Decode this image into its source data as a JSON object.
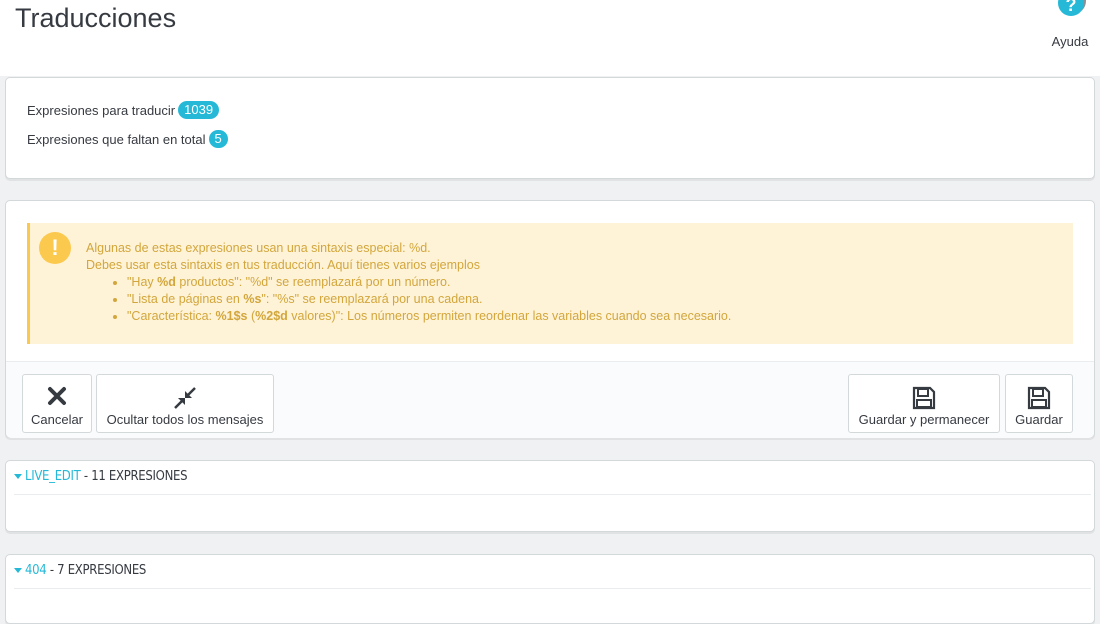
{
  "header": {
    "title": "Traducciones",
    "help_label": "Ayuda",
    "help_icon": "question-icon"
  },
  "stats": {
    "to_translate_label": "Expresiones para traducir",
    "to_translate_count": "1039",
    "missing_label": "Expresiones que faltan en total",
    "missing_count": "5"
  },
  "alert": {
    "icon": "exclamation-icon",
    "line1": "Algunas de estas expresiones usan una sintaxis especial: %d.",
    "line2": "Debes usar esta sintaxis en tus traducción. Aquí tienes varios ejemplos",
    "examples": [
      {
        "pre": "\"Hay ",
        "bold": "%d",
        "post": " productos\": \"%d\" se reemplazará por un número."
      },
      {
        "pre": "\"Lista de páginas en ",
        "bold": "%s",
        "post": "\": \"%s\" se reemplazará por una cadena."
      },
      {
        "pre": "\"Característica: ",
        "bold": "%1$s",
        "mid": " (",
        "bold2": "%2$d",
        "post": " valores)\": Los números permiten reordenar las variables cuando sea necesario."
      }
    ]
  },
  "toolbar": {
    "cancel_label": "Cancelar",
    "hide_label": "Ocultar todos los mensajes",
    "save_stay_label": "Guardar y permanecer",
    "save_label": "Guardar"
  },
  "sections": [
    {
      "name": "LIVE_EDIT",
      "count": " - 11 EXPRESIONES"
    },
    {
      "name": "404",
      "count": " - 7 EXPRESIONES"
    }
  ],
  "colors": {
    "accent": "#25b9d7",
    "warning_bg": "#fff3d7",
    "warning_text": "#d2a63c",
    "warning_icon": "#fcc94f"
  }
}
